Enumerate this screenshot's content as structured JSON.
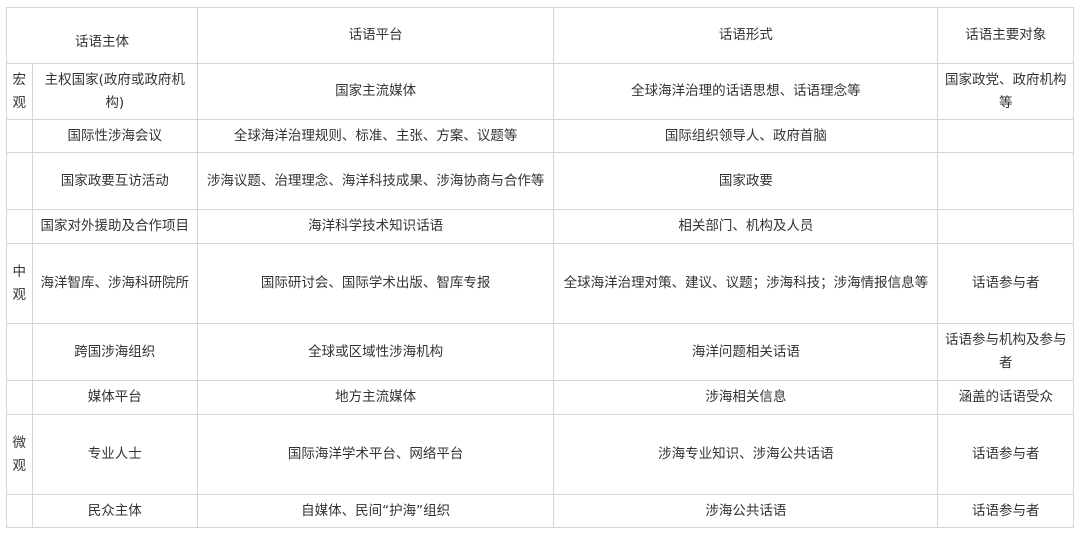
{
  "headers": {
    "subject": "话语主体",
    "platform": "话语平台",
    "form": "话语形式",
    "object": "话语主要对象"
  },
  "levels": {
    "macro": "宏观",
    "meso": "中观",
    "micro": "微观"
  },
  "rows": [
    {
      "subject": "主权国家(政府或政府机构)",
      "platform": "国家主流媒体",
      "form": "全球海洋治理的话语思想、话语理念等",
      "object": "国家政党、政府机构等"
    },
    {
      "subject": "国际性涉海会议",
      "platform": "全球海洋治理规则、标准、主张、方案、议题等",
      "form": "国际组织领导人、政府首脑",
      "object": ""
    },
    {
      "subject": "国家政要互访活动",
      "platform": "涉海议题、治理理念、海洋科技成果、涉海协商与合作等",
      "form": "国家政要",
      "object": ""
    },
    {
      "subject": "国家对外援助及合作项目",
      "platform": "海洋科学技术知识话语",
      "form": "相关部门、机构及人员",
      "object": ""
    },
    {
      "subject": "海洋智库、涉海科研院所",
      "platform": "国际研讨会、国际学术出版、智库专报",
      "form": "全球海洋治理对策、建议、议题；涉海科技；涉海情报信息等",
      "object": "话语参与者"
    },
    {
      "subject": "跨国涉海组织",
      "platform": "全球或区域性涉海机构",
      "form": "海洋问题相关话语",
      "object": "话语参与机构及参与者"
    },
    {
      "subject": "媒体平台",
      "platform": "地方主流媒体",
      "form": "涉海相关信息",
      "object": "涵盖的话语受众"
    },
    {
      "subject": "专业人士",
      "platform": "国际海洋学术平台、网络平台",
      "form": "涉海专业知识、涉海公共话语",
      "object": "话语参与者"
    },
    {
      "subject": "民众主体",
      "platform": "自媒体、民间“护海”组织",
      "form": "涉海公共话语",
      "object": "话语参与者"
    }
  ]
}
